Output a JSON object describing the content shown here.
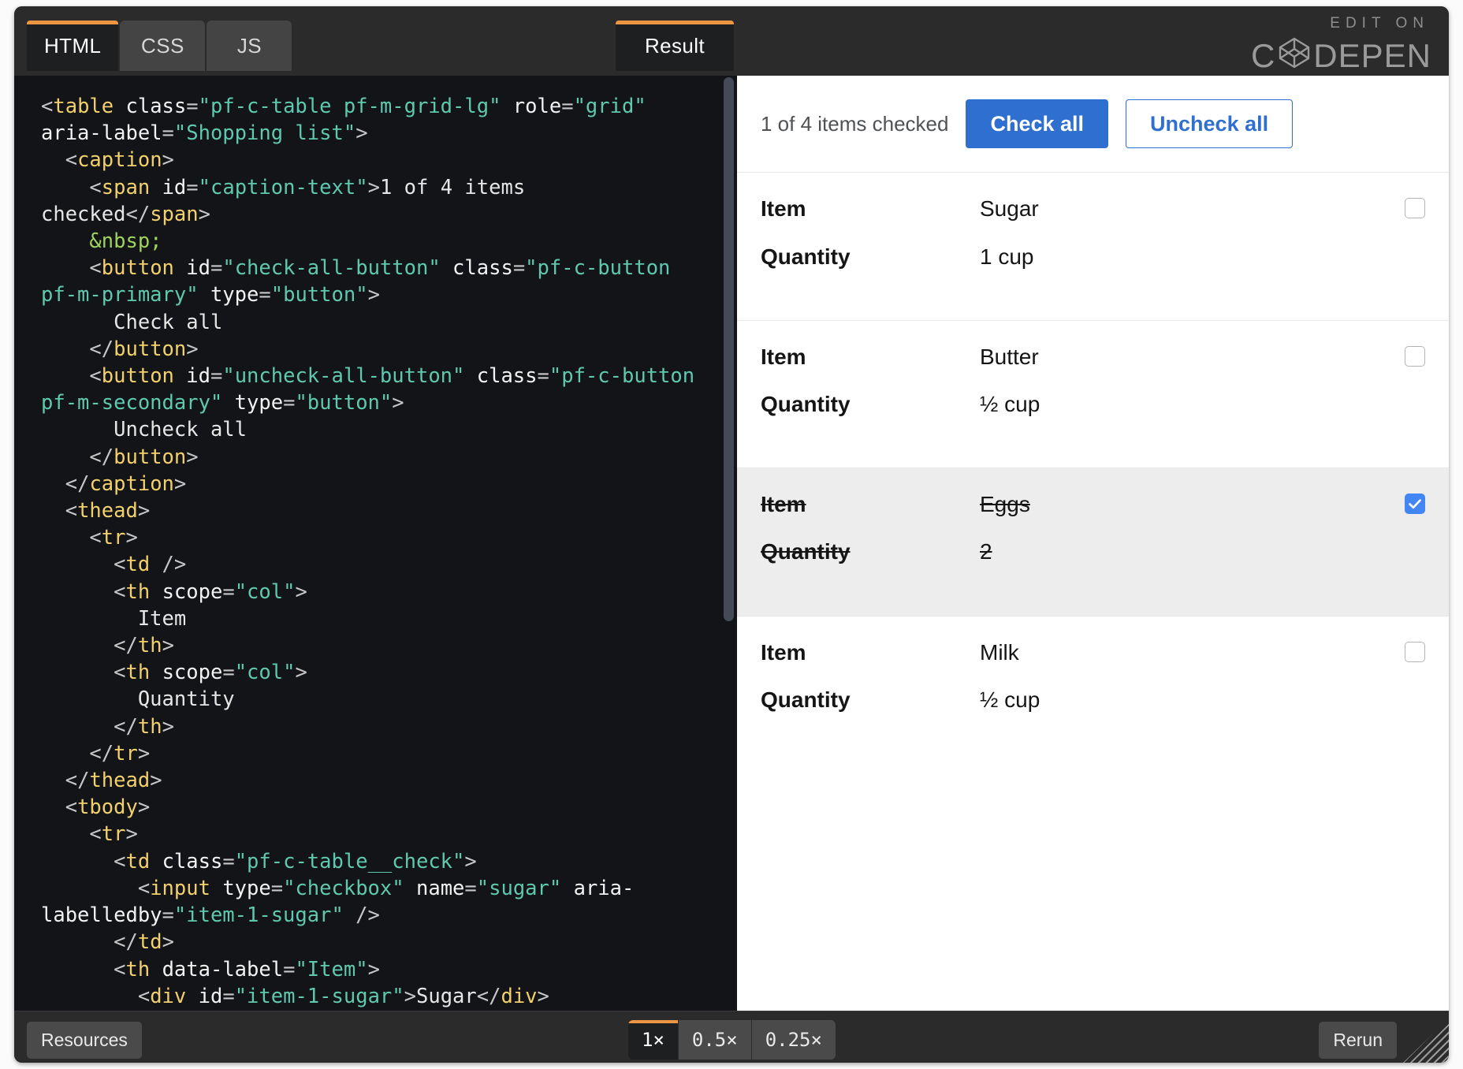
{
  "editor": {
    "tabs": [
      {
        "label": "HTML",
        "active": true
      },
      {
        "label": "CSS",
        "active": false
      },
      {
        "label": "JS",
        "active": false
      }
    ],
    "result_tab": "Result",
    "code_lines": [
      [
        [
          "punct",
          "<"
        ],
        [
          "tag",
          "table"
        ],
        [
          "text",
          " "
        ],
        [
          "attr",
          "class"
        ],
        [
          "punct",
          "="
        ],
        [
          "val",
          "\"pf-c-table pf-m-grid-lg\""
        ],
        [
          "text",
          " "
        ],
        [
          "attr",
          "role"
        ],
        [
          "punct",
          "="
        ],
        [
          "val",
          "\"grid\""
        ],
        [
          "text",
          " "
        ],
        [
          "attr",
          "aria-label"
        ],
        [
          "punct",
          "="
        ],
        [
          "val",
          "\"Shopping list\""
        ],
        [
          "punct",
          ">"
        ]
      ],
      [
        [
          "text",
          "  "
        ],
        [
          "punct",
          "<"
        ],
        [
          "tag",
          "caption"
        ],
        [
          "punct",
          ">"
        ]
      ],
      [
        [
          "text",
          "    "
        ],
        [
          "punct",
          "<"
        ],
        [
          "tag",
          "span"
        ],
        [
          "text",
          " "
        ],
        [
          "attr",
          "id"
        ],
        [
          "punct",
          "="
        ],
        [
          "val",
          "\"caption-text\""
        ],
        [
          "punct",
          ">"
        ],
        [
          "text",
          "1 of 4 items checked"
        ],
        [
          "punct",
          "</"
        ],
        [
          "tag",
          "span"
        ],
        [
          "punct",
          ">"
        ]
      ],
      [
        [
          "text",
          "    "
        ],
        [
          "ent",
          "&nbsp;"
        ]
      ],
      [
        [
          "text",
          "    "
        ],
        [
          "punct",
          "<"
        ],
        [
          "tag",
          "button"
        ],
        [
          "text",
          " "
        ],
        [
          "attr",
          "id"
        ],
        [
          "punct",
          "="
        ],
        [
          "val",
          "\"check-all-button\""
        ],
        [
          "text",
          " "
        ],
        [
          "attr",
          "class"
        ],
        [
          "punct",
          "="
        ],
        [
          "val",
          "\"pf-c-button pf-m-primary\""
        ],
        [
          "text",
          " "
        ],
        [
          "attr",
          "type"
        ],
        [
          "punct",
          "="
        ],
        [
          "val",
          "\"button\""
        ],
        [
          "punct",
          ">"
        ]
      ],
      [
        [
          "text",
          "      Check all"
        ]
      ],
      [
        [
          "text",
          "    "
        ],
        [
          "punct",
          "</"
        ],
        [
          "tag",
          "button"
        ],
        [
          "punct",
          ">"
        ]
      ],
      [
        [
          "text",
          "    "
        ],
        [
          "punct",
          "<"
        ],
        [
          "tag",
          "button"
        ],
        [
          "text",
          " "
        ],
        [
          "attr",
          "id"
        ],
        [
          "punct",
          "="
        ],
        [
          "val",
          "\"uncheck-all-button\""
        ],
        [
          "text",
          " "
        ],
        [
          "attr",
          "class"
        ],
        [
          "punct",
          "="
        ],
        [
          "val",
          "\"pf-c-button pf-m-secondary\""
        ],
        [
          "text",
          " "
        ],
        [
          "attr",
          "type"
        ],
        [
          "punct",
          "="
        ],
        [
          "val",
          "\"button\""
        ],
        [
          "punct",
          ">"
        ]
      ],
      [
        [
          "text",
          "      Uncheck all"
        ]
      ],
      [
        [
          "text",
          "    "
        ],
        [
          "punct",
          "</"
        ],
        [
          "tag",
          "button"
        ],
        [
          "punct",
          ">"
        ]
      ],
      [
        [
          "text",
          "  "
        ],
        [
          "punct",
          "</"
        ],
        [
          "tag",
          "caption"
        ],
        [
          "punct",
          ">"
        ]
      ],
      [
        [
          "text",
          "  "
        ],
        [
          "punct",
          "<"
        ],
        [
          "tag",
          "thead"
        ],
        [
          "punct",
          ">"
        ]
      ],
      [
        [
          "text",
          "    "
        ],
        [
          "punct",
          "<"
        ],
        [
          "tag",
          "tr"
        ],
        [
          "punct",
          ">"
        ]
      ],
      [
        [
          "text",
          "      "
        ],
        [
          "punct",
          "<"
        ],
        [
          "tag",
          "td"
        ],
        [
          "punct",
          " />"
        ]
      ],
      [
        [
          "text",
          "      "
        ],
        [
          "punct",
          "<"
        ],
        [
          "tag",
          "th"
        ],
        [
          "text",
          " "
        ],
        [
          "attr",
          "scope"
        ],
        [
          "punct",
          "="
        ],
        [
          "val",
          "\"col\""
        ],
        [
          "punct",
          ">"
        ]
      ],
      [
        [
          "text",
          "        Item"
        ]
      ],
      [
        [
          "text",
          "      "
        ],
        [
          "punct",
          "</"
        ],
        [
          "tag",
          "th"
        ],
        [
          "punct",
          ">"
        ]
      ],
      [
        [
          "text",
          "      "
        ],
        [
          "punct",
          "<"
        ],
        [
          "tag",
          "th"
        ],
        [
          "text",
          " "
        ],
        [
          "attr",
          "scope"
        ],
        [
          "punct",
          "="
        ],
        [
          "val",
          "\"col\""
        ],
        [
          "punct",
          ">"
        ]
      ],
      [
        [
          "text",
          "        Quantity"
        ]
      ],
      [
        [
          "text",
          "      "
        ],
        [
          "punct",
          "</"
        ],
        [
          "tag",
          "th"
        ],
        [
          "punct",
          ">"
        ]
      ],
      [
        [
          "text",
          "    "
        ],
        [
          "punct",
          "</"
        ],
        [
          "tag",
          "tr"
        ],
        [
          "punct",
          ">"
        ]
      ],
      [
        [
          "text",
          "  "
        ],
        [
          "punct",
          "</"
        ],
        [
          "tag",
          "thead"
        ],
        [
          "punct",
          ">"
        ]
      ],
      [
        [
          "text",
          "  "
        ],
        [
          "punct",
          "<"
        ],
        [
          "tag",
          "tbody"
        ],
        [
          "punct",
          ">"
        ]
      ],
      [
        [
          "text",
          "    "
        ],
        [
          "punct",
          "<"
        ],
        [
          "tag",
          "tr"
        ],
        [
          "punct",
          ">"
        ]
      ],
      [
        [
          "text",
          "      "
        ],
        [
          "punct",
          "<"
        ],
        [
          "tag",
          "td"
        ],
        [
          "text",
          " "
        ],
        [
          "attr",
          "class"
        ],
        [
          "punct",
          "="
        ],
        [
          "val",
          "\"pf-c-table__check\""
        ],
        [
          "punct",
          ">"
        ]
      ],
      [
        [
          "text",
          "        "
        ],
        [
          "punct",
          "<"
        ],
        [
          "tag",
          "input"
        ],
        [
          "text",
          " "
        ],
        [
          "attr",
          "type"
        ],
        [
          "punct",
          "="
        ],
        [
          "val",
          "\"checkbox\""
        ],
        [
          "text",
          " "
        ],
        [
          "attr",
          "name"
        ],
        [
          "punct",
          "="
        ],
        [
          "val",
          "\"sugar\""
        ],
        [
          "text",
          " "
        ],
        [
          "attr",
          "aria-labelledby"
        ],
        [
          "punct",
          "="
        ],
        [
          "val",
          "\"item-1-sugar\""
        ],
        [
          "punct",
          " />"
        ]
      ],
      [
        [
          "text",
          "      "
        ],
        [
          "punct",
          "</"
        ],
        [
          "tag",
          "td"
        ],
        [
          "punct",
          ">"
        ]
      ],
      [
        [
          "text",
          "      "
        ],
        [
          "punct",
          "<"
        ],
        [
          "tag",
          "th"
        ],
        [
          "text",
          " "
        ],
        [
          "attr",
          "data-label"
        ],
        [
          "punct",
          "="
        ],
        [
          "val",
          "\"Item\""
        ],
        [
          "punct",
          ">"
        ]
      ],
      [
        [
          "text",
          "        "
        ],
        [
          "punct",
          "<"
        ],
        [
          "tag",
          "div"
        ],
        [
          "text",
          " "
        ],
        [
          "attr",
          "id"
        ],
        [
          "punct",
          "="
        ],
        [
          "val",
          "\"item-1-sugar\""
        ],
        [
          "punct",
          ">"
        ],
        [
          "text",
          "Sugar"
        ],
        [
          "punct",
          "</"
        ],
        [
          "tag",
          "div"
        ],
        [
          "punct",
          ">"
        ]
      ]
    ]
  },
  "result": {
    "caption_text": "1 of 4 items checked",
    "check_all_label": "Check all",
    "uncheck_all_label": "Uncheck all",
    "column_labels": {
      "item": "Item",
      "quantity": "Quantity"
    },
    "rows": [
      {
        "item_label": "Item",
        "item": "Sugar",
        "quantity_label": "Quantity",
        "quantity": "1 cup",
        "checked": false
      },
      {
        "item_label": "Item",
        "item": "Butter",
        "quantity_label": "Quantity",
        "quantity": "½ cup",
        "checked": false
      },
      {
        "item_label": "Item",
        "item": "Eggs",
        "quantity_label": "Quantity",
        "quantity": "2",
        "checked": true
      },
      {
        "item_label": "Item",
        "item": "Milk",
        "quantity_label": "Quantity",
        "quantity": "½ cup",
        "checked": false
      }
    ]
  },
  "branding": {
    "edit_on": "EDIT ON",
    "wordmark_before": "C",
    "wordmark_after": "DEPEN"
  },
  "bottom_bar": {
    "resources_label": "Resources",
    "rerun_label": "Rerun",
    "zoom_levels": [
      {
        "label": "1×",
        "active": true
      },
      {
        "label": "0.5×",
        "active": false
      },
      {
        "label": "0.25×",
        "active": false
      }
    ]
  },
  "colors": {
    "accent_orange": "#ec9543",
    "primary_blue": "#2f6fd0",
    "checkbox_blue": "#4285f4",
    "editor_bg": "#131417",
    "chrome_bg": "#2b2b2b"
  }
}
